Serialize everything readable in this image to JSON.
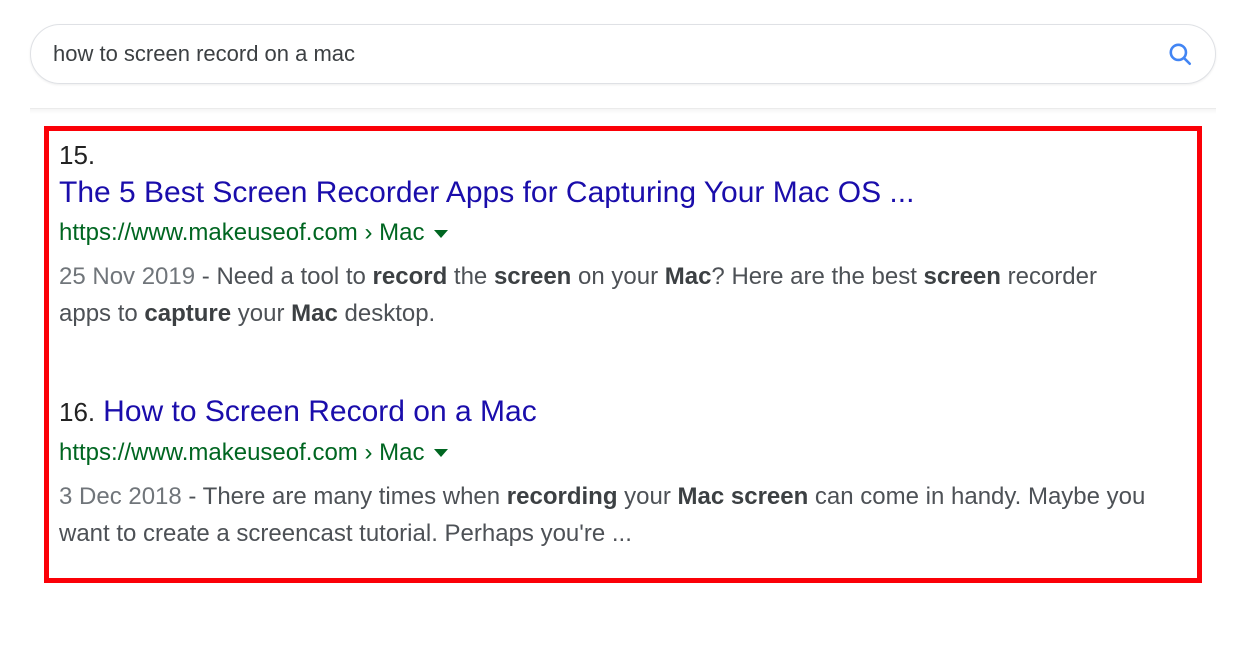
{
  "search": {
    "query": "how to screen record on a mac"
  },
  "results": [
    {
      "number": "15.",
      "title": "The 5 Best Screen Recorder Apps for Capturing Your Mac OS ...",
      "url_display": "https://www.makeuseof.com › Mac",
      "date": "25 Nov 2019",
      "snippet_html": "Need a tool to <b>record</b> the <b>screen</b> on your <b>Mac</b>? Here are the best <b>screen</b> recorder apps to <b>capture</b> your <b>Mac</b> desktop.",
      "number_inline": false
    },
    {
      "number": "16.",
      "title": "How to Screen Record on a Mac",
      "url_display": "https://www.makeuseof.com › Mac",
      "date": "3 Dec 2018",
      "snippet_html": "There are many times when <b>recording</b> your <b>Mac screen</b> can come in handy. Maybe you want to create a screencast tutorial. Perhaps you're ...",
      "number_inline": true
    }
  ]
}
